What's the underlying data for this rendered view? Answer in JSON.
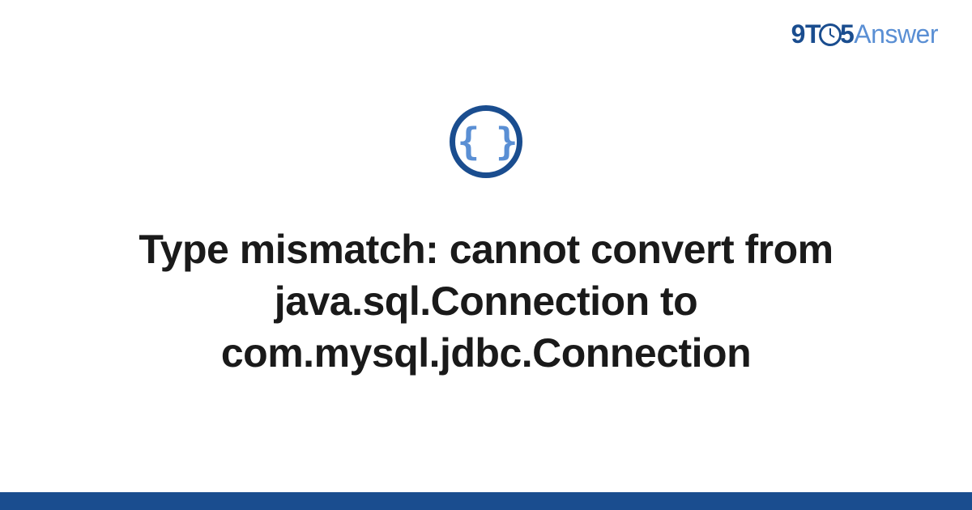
{
  "logo": {
    "part1": "9T",
    "part2": "5",
    "part3": "Answer"
  },
  "icon": {
    "name": "code-braces-icon",
    "glyph": "{ }"
  },
  "title": "Type mismatch: cannot convert from java.sql.Connection to com.mysql.jdbc.Connection",
  "colors": {
    "primary": "#1a4d8f",
    "accent": "#5a8fd4",
    "text": "#1a1a1a",
    "background": "#ffffff"
  }
}
